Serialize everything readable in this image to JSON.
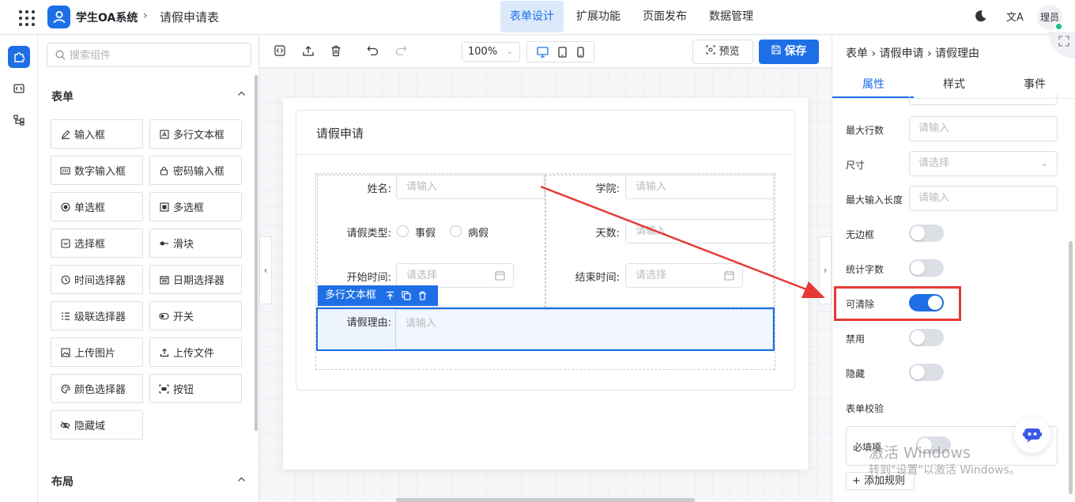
{
  "header": {
    "app_title": "学生OA系统",
    "separator": "›",
    "page_name": "请假申请表",
    "tabs": [
      {
        "label": "表单设计",
        "active": true
      },
      {
        "label": "扩展功能",
        "active": false
      },
      {
        "label": "页面发布",
        "active": false
      },
      {
        "label": "数据管理",
        "active": false
      }
    ],
    "translate_icon": "文A",
    "user_label": "理员"
  },
  "components": {
    "search_placeholder": "搜索组件",
    "form_section": "表单",
    "layout_section": "布局",
    "items": [
      {
        "label": "输入框",
        "icon": "pencil-icon"
      },
      {
        "label": "多行文本框",
        "icon": "textarea-icon"
      },
      {
        "label": "数字输入框",
        "icon": "number-icon"
      },
      {
        "label": "密码输入框",
        "icon": "lock-icon"
      },
      {
        "label": "单选框",
        "icon": "radio-icon"
      },
      {
        "label": "多选框",
        "icon": "checkbox-icon"
      },
      {
        "label": "选择框",
        "icon": "select-icon"
      },
      {
        "label": "滑块",
        "icon": "slider-icon"
      },
      {
        "label": "时间选择器",
        "icon": "clock-icon"
      },
      {
        "label": "日期选择器",
        "icon": "calendar-icon"
      },
      {
        "label": "级联选择器",
        "icon": "cascader-icon"
      },
      {
        "label": "开关",
        "icon": "switch-icon"
      },
      {
        "label": "上传图片",
        "icon": "image-icon"
      },
      {
        "label": "上传文件",
        "icon": "upload-icon"
      },
      {
        "label": "颜色选择器",
        "icon": "palette-icon"
      },
      {
        "label": "按钮",
        "icon": "button-icon"
      },
      {
        "label": "隐藏域",
        "icon": "eye-off-icon"
      }
    ]
  },
  "toolbar": {
    "zoom": "100%",
    "preview_label": "预览",
    "save_label": "保存"
  },
  "form": {
    "title": "请假申请",
    "name_label": "姓名:",
    "name_placeholder": "请输入",
    "college_label": "学院:",
    "college_placeholder": "请输入",
    "leave_type_label": "请假类型:",
    "leave_options": [
      "事假",
      "病假"
    ],
    "days_label": "天数:",
    "days_placeholder": "请输入",
    "start_label": "开始时间:",
    "start_placeholder": "请选择",
    "end_label": "结束时间:",
    "end_placeholder": "请选择",
    "selected_badge": "多行文本框",
    "reason_label": "请假理由:",
    "reason_placeholder": "请输入"
  },
  "properties": {
    "breadcrumb": "表单 › 请假申请 › 请假理由",
    "tabs": [
      "属性",
      "样式",
      "事件"
    ],
    "max_rows_label": "最大行数",
    "max_rows_placeholder": "请输入",
    "size_label": "尺寸",
    "size_placeholder": "请选择",
    "max_length_label": "最大输入长度",
    "max_length_placeholder": "请输入",
    "toggles": [
      {
        "label": "无边框",
        "on": false
      },
      {
        "label": "统计字数",
        "on": false
      },
      {
        "label": "可清除",
        "on": true
      },
      {
        "label": "禁用",
        "on": false
      },
      {
        "label": "隐藏",
        "on": false
      }
    ],
    "validation_label": "表单校验",
    "required_label": "必填项",
    "add_rule_label": "+ 添加规则"
  },
  "watermark": {
    "line1": "激活 Windows",
    "line2": "转到\"设置\"以激活 Windows。"
  },
  "colors": {
    "accent": "#1e6fe6",
    "highlight": "#e53935"
  }
}
